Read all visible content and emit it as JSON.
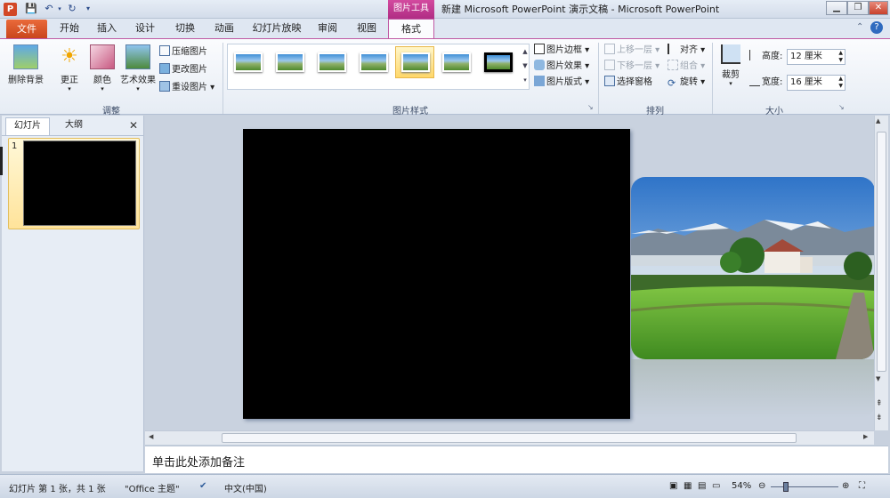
{
  "titlebar": {
    "app_icon": "P",
    "contextual_group": "图片工具",
    "title": "新建 Microsoft PowerPoint 演示文稿 - Microsoft PowerPoint",
    "quick_access": [
      "save-icon",
      "undo-icon",
      "redo-icon",
      "customize-icon"
    ],
    "window_buttons": [
      "minimize",
      "restore",
      "close"
    ]
  },
  "tabs": {
    "file": "文件",
    "home": "开始",
    "insert": "插入",
    "design": "设计",
    "transitions": "切换",
    "animations": "动画",
    "slideshow": "幻灯片放映",
    "review": "审阅",
    "view": "视图",
    "format": "格式"
  },
  "ribbon": {
    "adjust": {
      "label": "调整",
      "remove_bg": "删除背景",
      "corrections": "更正",
      "color": "颜色",
      "artistic": "艺术效果",
      "compress": "压缩图片",
      "change": "更改图片",
      "reset": "重设图片"
    },
    "styles": {
      "label": "图片样式",
      "border": "图片边框",
      "effects": "图片效果",
      "layout": "图片版式"
    },
    "arrange": {
      "label": "排列",
      "bring_forward": "上移一层",
      "send_backward": "下移一层",
      "selection_pane": "选择窗格",
      "align": "对齐",
      "group": "组合",
      "rotate": "旋转"
    },
    "size": {
      "label": "大小",
      "crop": "裁剪",
      "height_label": "高度:",
      "height_value": "12 厘米",
      "width_label": "宽度:",
      "width_value": "16 厘米"
    }
  },
  "left_pane": {
    "tab_slides": "幻灯片",
    "tab_outline": "大纲",
    "close": "✕",
    "slide_number": "1"
  },
  "notes": {
    "placeholder": "单击此处添加备注"
  },
  "status": {
    "slide_info": "幻灯片 第 1 张，共 1 张",
    "theme": "\"Office 主题\"",
    "language": "中文(中国)",
    "zoom": "54%"
  },
  "colors": {
    "file_tab": "#d24726",
    "context_tab": "#c0398f",
    "ribbon_bg": "#f1f5fa"
  }
}
